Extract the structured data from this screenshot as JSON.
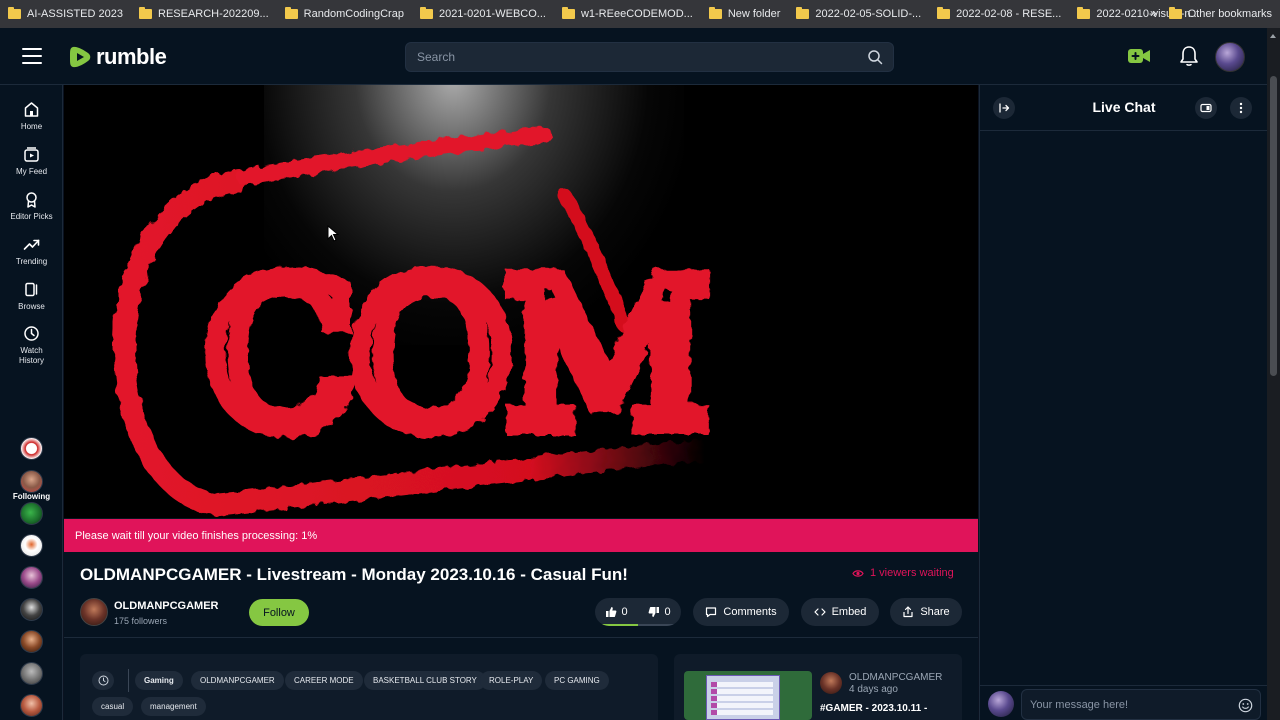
{
  "bookmarks": {
    "items": [
      "AI-ASSISTED 2023",
      "RESEARCH-202209...",
      "RandomCodingCrap",
      "2021-0201-WEBCO...",
      "w1-REeeCODEMOD...",
      "New folder",
      "2022-02-05-SOLID-...",
      "2022-02-08 - RESE...",
      "2022-0210-visual-n..."
    ],
    "more": "»",
    "other": "Other bookmarks"
  },
  "header": {
    "logo_text": "rumble",
    "search_placeholder": "Search"
  },
  "sidebar": {
    "items": [
      {
        "label": "Home",
        "icon": "home-icon"
      },
      {
        "label": "My Feed",
        "icon": "feed-icon"
      },
      {
        "label": "Editor Picks",
        "icon": "award-icon"
      },
      {
        "label": "Trending",
        "icon": "trending-icon"
      },
      {
        "label": "Browse",
        "icon": "browse-icon"
      },
      {
        "label": "Watch History",
        "icon": "history-icon"
      }
    ],
    "following_label": "Following",
    "following_count": 9
  },
  "video": {
    "processing_text": "Please wait till your video finishes processing: 1%",
    "processing_percent": 1,
    "frame_text": "COM"
  },
  "info": {
    "title": "OLDMANPCGAMER - Livestream - Monday 2023.10.16 - Casual Fun!",
    "viewers_waiting": "1 viewers waiting",
    "channel_name": "OLDMANPCGAMER",
    "followers": "175 followers",
    "follow_label": "Follow",
    "likes": "0",
    "dislikes": "0",
    "comments_label": "Comments",
    "embed_label": "Embed",
    "share_label": "Share",
    "tags": [
      "Gaming",
      "OLDMANPCGAMER",
      "CAREER MODE",
      "BASKETBALL CLUB STORY",
      "ROLE-PLAY",
      "PC GAMING",
      "casual",
      "management"
    ]
  },
  "related": {
    "channel": "OLDMANPCGAMER",
    "ago": "4 days ago",
    "title": "#GAMER - 2023.10.11 -"
  },
  "chat": {
    "title": "Live Chat",
    "input_placeholder": "Your message here!"
  },
  "colors": {
    "brand_green": "#85c742",
    "accent_pink": "#e0145a",
    "background": "#061320"
  }
}
